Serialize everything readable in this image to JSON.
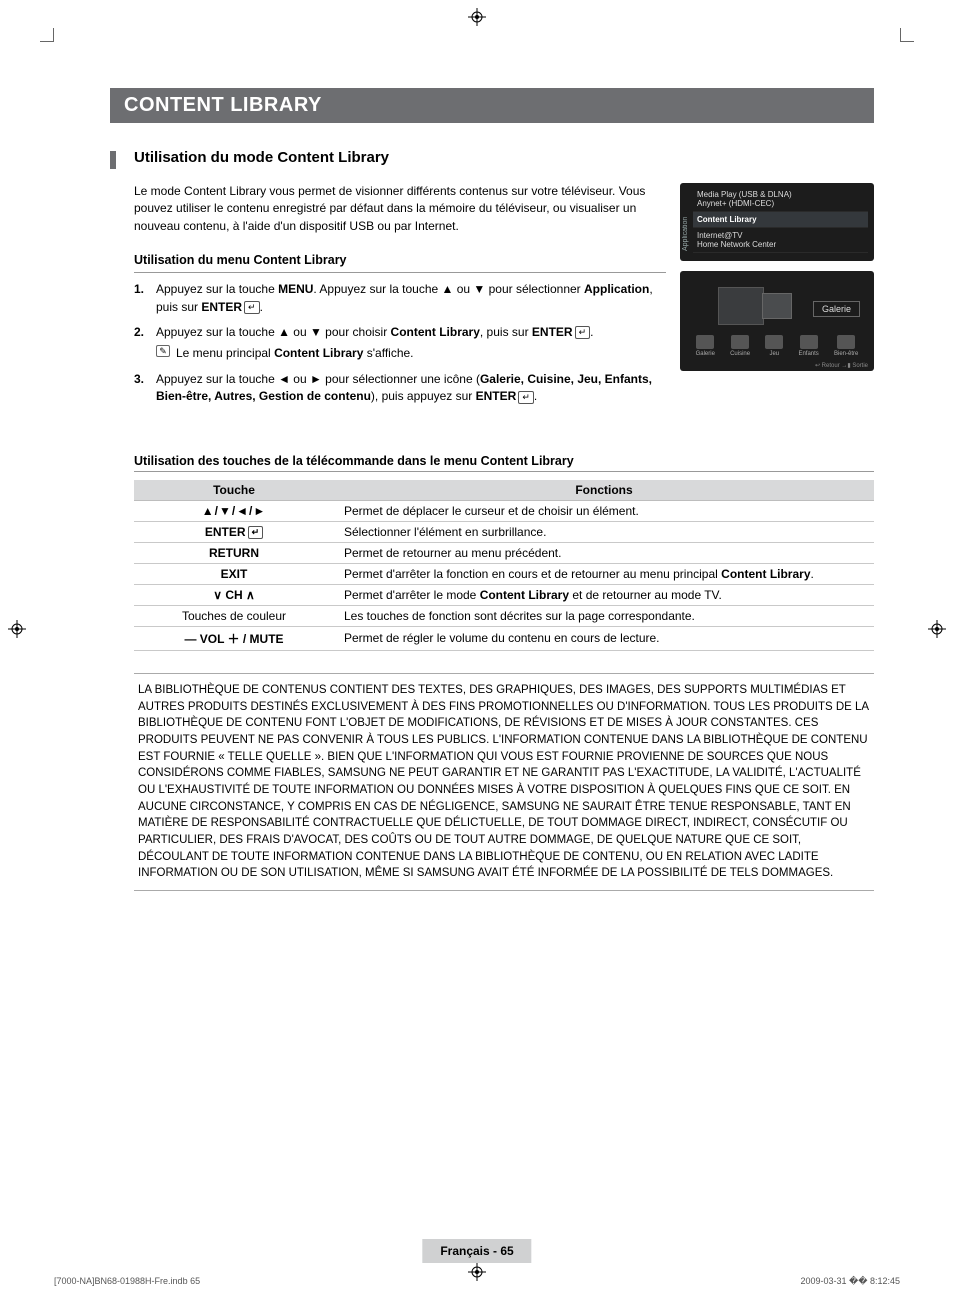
{
  "header": {
    "title": "CONTENT LIBRARY"
  },
  "section": {
    "heading": "Utilisation du mode Content Library",
    "intro": "Le mode Content Library vous permet de visionner différents contenus sur votre téléviseur. Vous pouvez utiliser le contenu enregistré par défaut dans la mémoire du téléviseur, ou visualiser un nouveau contenu, à l'aide d'un dispositif USB ou par Internet."
  },
  "menu_usage": {
    "heading": "Utilisation du menu Content Library",
    "steps": [
      {
        "n": "1.",
        "pre": "Appuyez sur la touche ",
        "b1": "MENU",
        "mid1": ". Appuyez sur la touche ▲ ou ▼ pour sélectionner ",
        "b2": "Application",
        "mid2": ", puis sur ",
        "b3": "ENTER",
        "tail": "."
      },
      {
        "n": "2.",
        "pre": "Appuyez sur la touche ▲ ou ▼ pour choisir ",
        "b1": "Content Library",
        "mid1": ", puis sur ",
        "b2": "ENTER",
        "tail": ".",
        "note_pre": "Le menu principal ",
        "note_b": "Content Library",
        "note_post": " s'affiche."
      },
      {
        "n": "3.",
        "pre": "Appuyez sur la touche ◄ ou ► pour sélectionner une icône (",
        "b1": "Galerie, Cuisine, Jeu, Enfants, Bien-être, Autres, Gestion de contenu",
        "mid1": "), puis appuyez sur ",
        "b2": "ENTER",
        "tail": "."
      }
    ]
  },
  "screen1": {
    "side": "Application",
    "items": [
      {
        "label": "Media Play (USB & DLNA)",
        "sub": "Anynet+ (HDMI-CEC)",
        "sel": false
      },
      {
        "label": "Content Library",
        "sel": true
      },
      {
        "label": "Internet@TV",
        "sub": "Home Network Center",
        "sel": false
      }
    ]
  },
  "screen2": {
    "selected": "Galerie",
    "icons": [
      "Galerie",
      "Cuisine",
      "Jeu",
      "Enfants",
      "Bien-être"
    ],
    "footer": "↩ Retour    →▮ Sortie"
  },
  "remote": {
    "heading": "Utilisation des touches de la télécommande dans le menu Content Library",
    "th_key": "Touche",
    "th_fn": "Fonctions",
    "rows": [
      {
        "key_sym": "▲/▼/◄/►",
        "fn": "Permet de déplacer le curseur et de choisir un élément."
      },
      {
        "key_txt": "ENTER",
        "enter_icon": true,
        "fn": "Sélectionner l'élément en surbrillance."
      },
      {
        "key_txt": "RETURN",
        "fn": "Permet de retourner au menu précédent."
      },
      {
        "key_txt": "EXIT",
        "fn_pre": "Permet d'arrêter la fonction en cours et de retourner au menu principal ",
        "fn_b": "Content Library",
        "fn_post": "."
      },
      {
        "key_sym": "∨ CH ∧",
        "fn_pre": "Permet d'arrêter le mode ",
        "fn_b": "Content Library",
        "fn_post": " et de retourner au mode TV."
      },
      {
        "key_plain": "Touches de couleur",
        "fn": "Les touches de fonction sont décrites sur la page correspondante."
      },
      {
        "key_sym": "— VOL ＋ / MUTE",
        "fn": "Permet de régler le volume du contenu en cours de lecture."
      }
    ]
  },
  "disclaimer": "LA BIBLIOTHÈQUE DE CONTENUS CONTIENT DES TEXTES, DES GRAPHIQUES, DES IMAGES, DES SUPPORTS MULTIMÉDIAS ET AUTRES PRODUITS DESTINÉS EXCLUSIVEMENT À DES FINS PROMOTIONNELLES OU D'INFORMATION. TOUS LES PRODUITS DE LA BIBLIOTHÈQUE DE CONTENU FONT L'OBJET DE MODIFICATIONS, DE RÉVISIONS ET DE MISES À JOUR CONSTANTES. CES PRODUITS PEUVENT NE PAS CONVENIR À TOUS LES PUBLICS. L'INFORMATION CONTENUE DANS LA BIBLIOTHÈQUE DE CONTENU EST FOURNIE « TELLE QUELLE ». BIEN QUE L'INFORMATION QUI VOUS EST FOURNIE PROVIENNE DE SOURCES QUE NOUS CONSIDÉRONS COMME FIABLES, SAMSUNG NE PEUT GARANTIR ET NE GARANTIT PAS L'EXACTITUDE, LA VALIDITÉ, L'ACTUALITÉ OU L'EXHAUSTIVITÉ DE TOUTE INFORMATION OU DONNÉES MISES À VOTRE DISPOSITION À QUELQUES FINS QUE CE SOIT. EN AUCUNE CIRCONSTANCE, Y COMPRIS EN CAS DE NÉGLIGENCE, SAMSUNG NE SAURAIT ÊTRE TENUE RESPONSABLE, TANT EN MATIÈRE DE RESPONSABILITÉ CONTRACTUELLE QUE DÉLICTUELLE, DE TOUT DOMMAGE DIRECT, INDIRECT, CONSÉCUTIF OU PARTICULIER, DES FRAIS D'AVOCAT, DES COÛTS OU DE TOUT AUTRE DOMMAGE, DE QUELQUE NATURE QUE CE SOIT, DÉCOULANT DE TOUTE INFORMATION CONTENUE DANS LA BIBLIOTHÈQUE DE CONTENU, OU EN RELATION AVEC LADITE INFORMATION OU DE SON UTILISATION, MÊME SI SAMSUNG AVAIT ÉTÉ INFORMÉE DE LA POSSIBILITÉ DE TELS DOMMAGES.",
  "footer": {
    "page": "Français - 65"
  },
  "print": {
    "left": "[7000-NA]BN68-01988H-Fre.indb   65",
    "right": "2009-03-31   �� 8:12:45"
  }
}
